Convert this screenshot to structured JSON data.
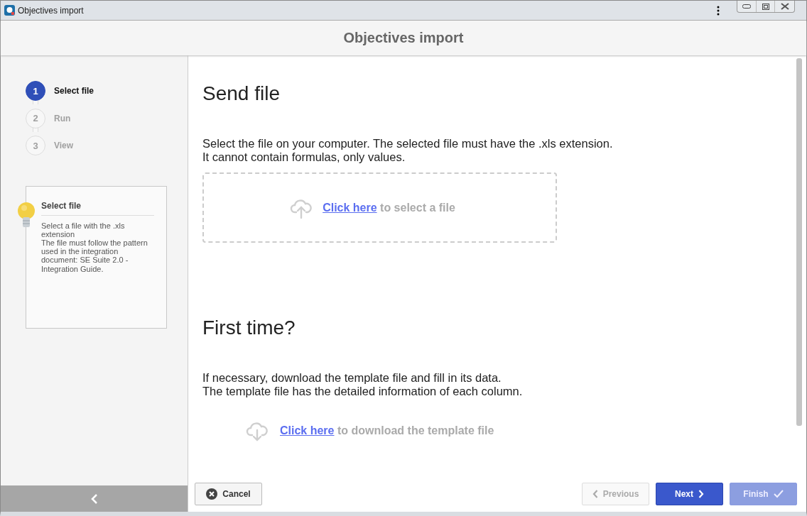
{
  "window": {
    "title": "Objectives import"
  },
  "header": {
    "title": "Objectives import"
  },
  "steps": [
    {
      "number": "1",
      "label": "Select file",
      "selected": true
    },
    {
      "number": "2",
      "label": "Run",
      "selected": false
    },
    {
      "number": "3",
      "label": "View",
      "selected": false
    }
  ],
  "tip": {
    "title": "Select file",
    "lines": [
      "Select a file with the .xls extension",
      "The file must follow the pattern used in the integration document: SE Suite 2.0 - Integration Guide."
    ]
  },
  "send_file": {
    "title": "Send file",
    "lines": [
      "Select the file on your computer. The selected file must have the .xls extension.",
      "It cannot contain formulas, only values."
    ],
    "link": "Click here",
    "text": "to select a file"
  },
  "first_time": {
    "title": "First time?",
    "lines": [
      "If necessary, download the template file and fill in its data.",
      "The template file has the detailed information of each column."
    ],
    "link": "Click here",
    "text": "to download the template file"
  },
  "buttons": [
    {
      "kind": "cancel",
      "label": "Cancel",
      "disabled": false
    },
    {
      "kind": "previous",
      "label": "Previous",
      "disabled": true
    },
    {
      "kind": "next",
      "label": "Next",
      "disabled": false
    },
    {
      "kind": "finish",
      "label": "Finish",
      "disabled": true
    }
  ]
}
